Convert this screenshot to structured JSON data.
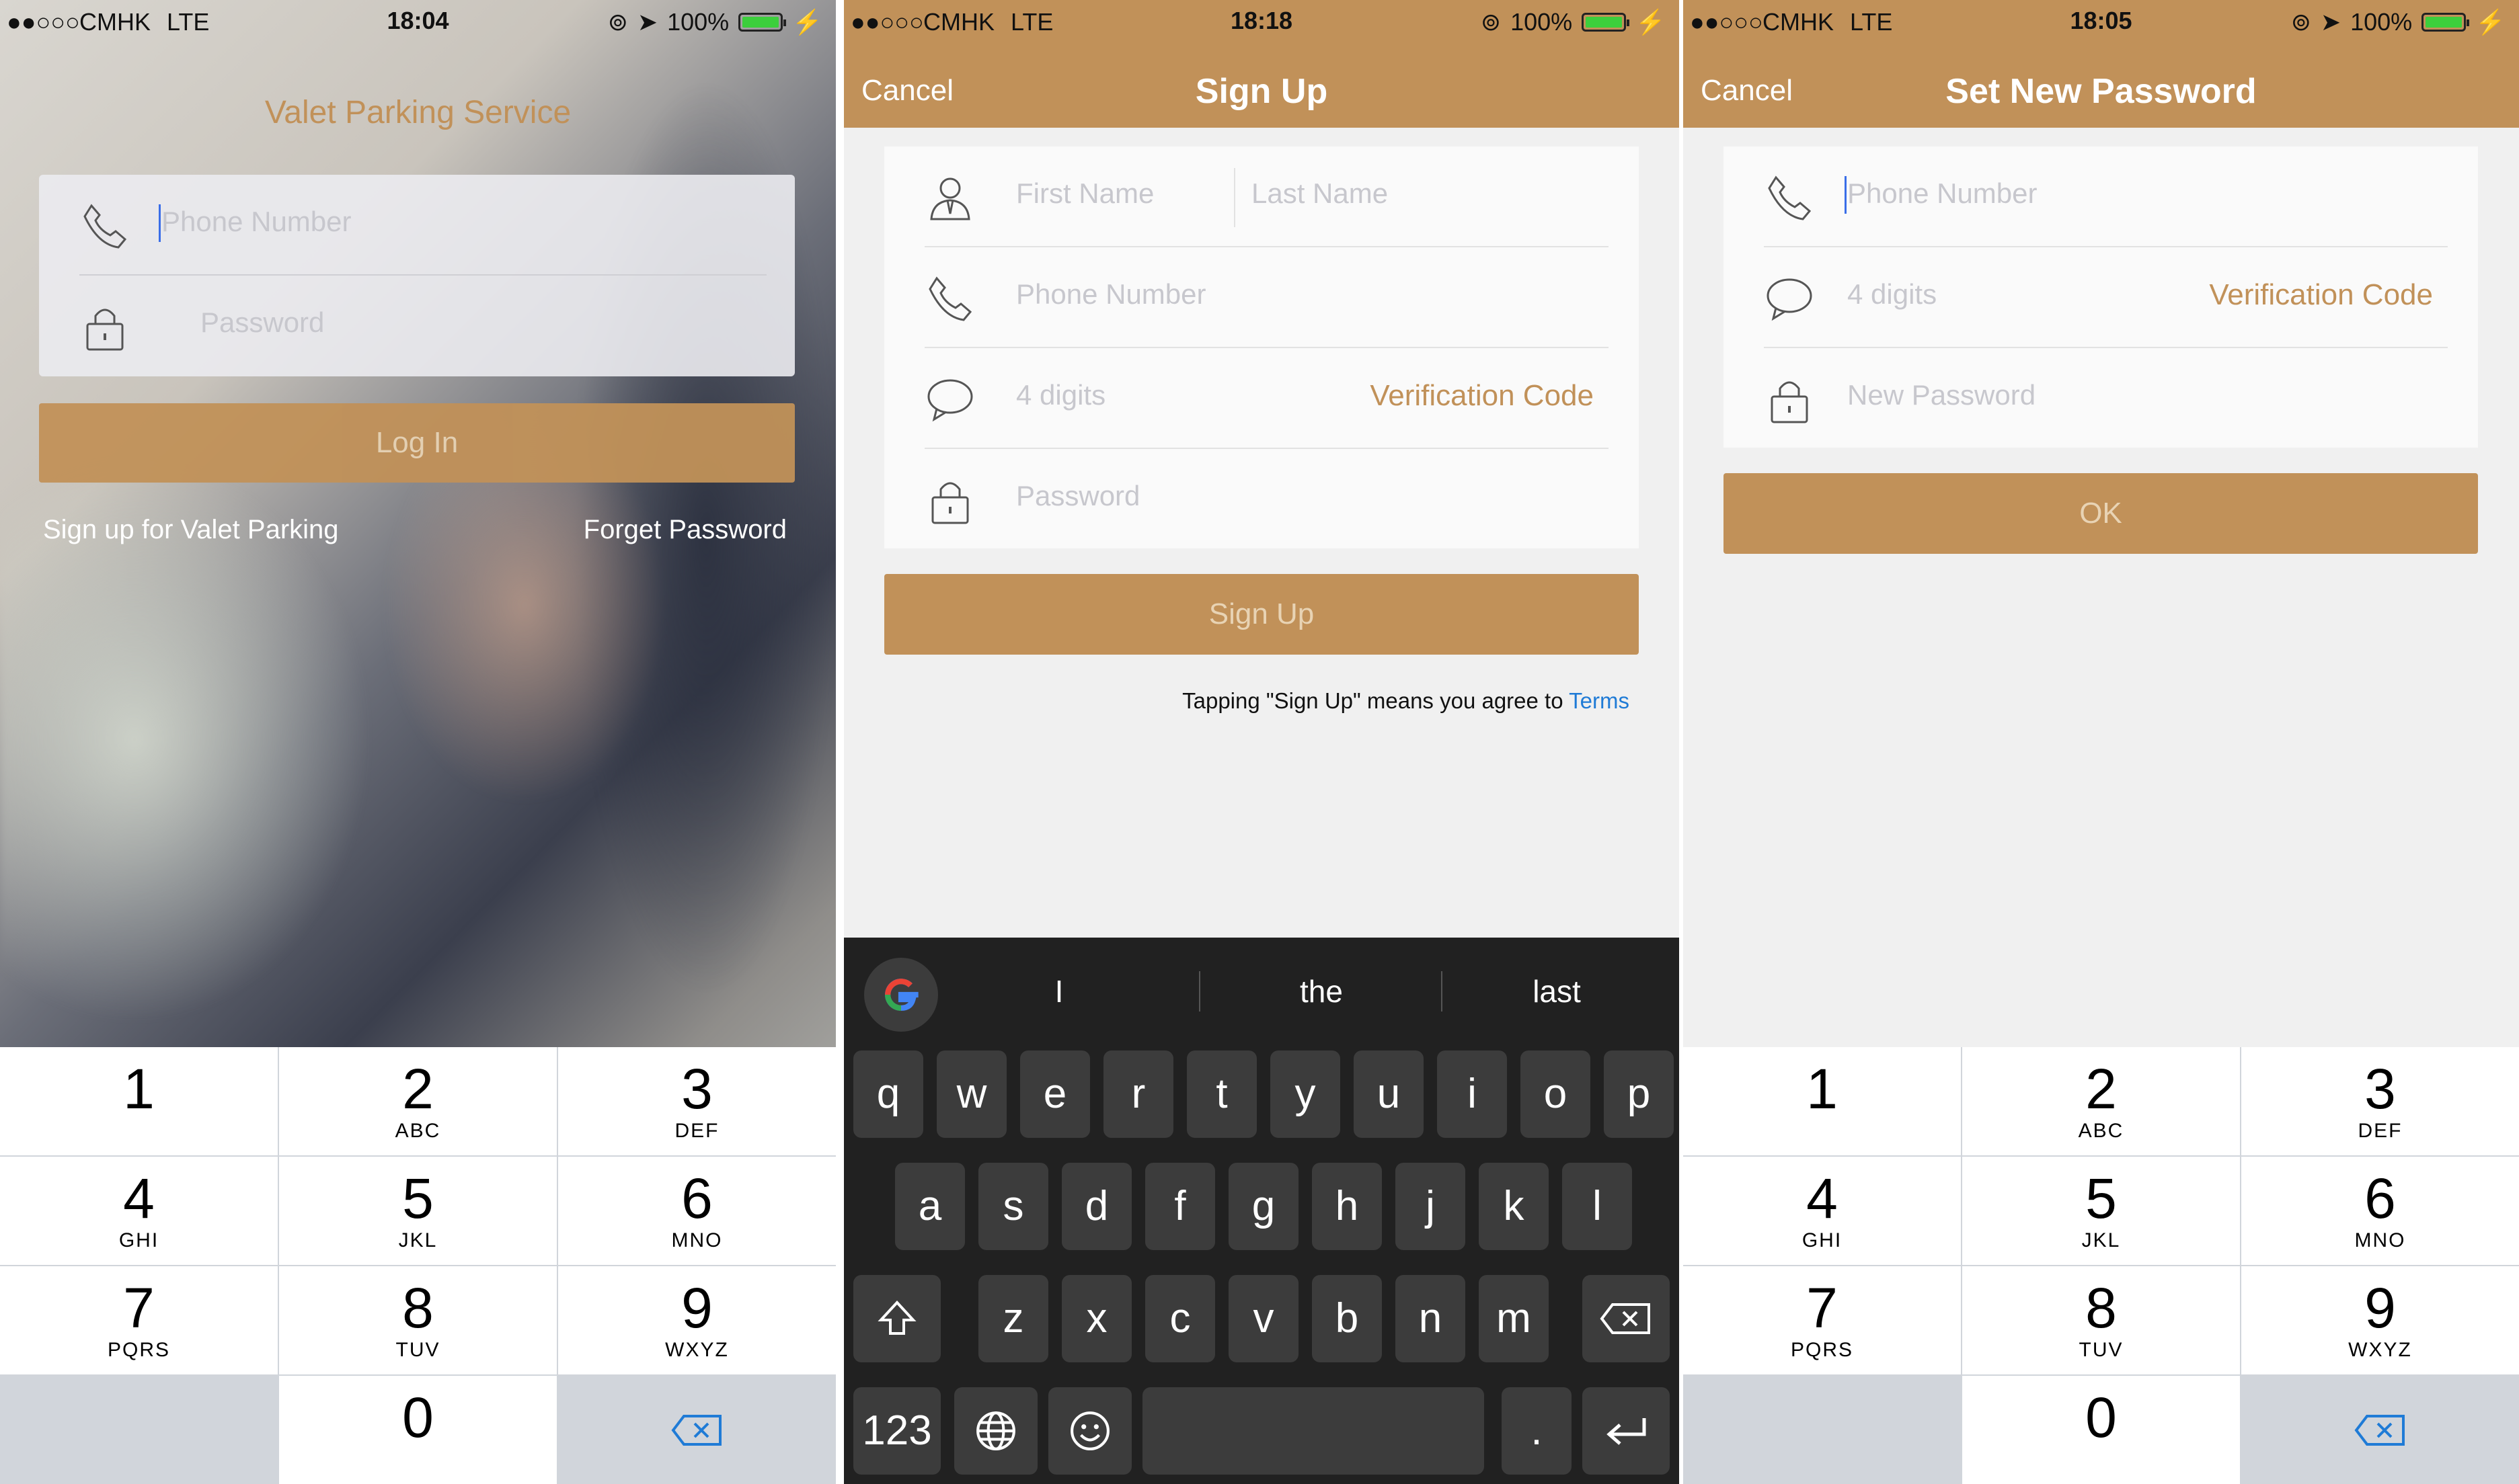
{
  "screen1": {
    "status": {
      "carrier": "CMHK",
      "network": "LTE",
      "time": "18:04",
      "battery": "100%"
    },
    "app_title": "Valet Parking Service",
    "phone_placeholder": "Phone Number",
    "password_placeholder": "Password",
    "login_label": "Log In",
    "signup_link": "Sign up for Valet Parking",
    "forget_link": "Forget Password"
  },
  "screen2": {
    "status": {
      "carrier": "CMHK",
      "network": "LTE",
      "time": "18:18",
      "battery": "100%"
    },
    "cancel": "Cancel",
    "title": "Sign Up",
    "first_name_placeholder": "First Name",
    "last_name_placeholder": "Last Name",
    "phone_placeholder": "Phone Number",
    "code_placeholder": "4 digits",
    "verification_code": "Verification Code",
    "password_placeholder": "Password",
    "signup_label": "Sign Up",
    "terms_text": "Tapping \"Sign Up\" means you agree to",
    "terms_link": "Terms",
    "keyboard": {
      "suggestions": [
        "I",
        "the",
        "last"
      ],
      "row1": [
        "q",
        "w",
        "e",
        "r",
        "t",
        "y",
        "u",
        "i",
        "o",
        "p"
      ],
      "row2": [
        "a",
        "s",
        "d",
        "f",
        "g",
        "h",
        "j",
        "k",
        "l"
      ],
      "row3": [
        "z",
        "x",
        "c",
        "v",
        "b",
        "n",
        "m"
      ],
      "num_key": "123",
      "period_key": "."
    }
  },
  "screen3": {
    "status": {
      "carrier": "CMHK",
      "network": "LTE",
      "time": "18:05",
      "battery": "100%"
    },
    "cancel": "Cancel",
    "title": "Set New Password",
    "phone_placeholder": "Phone Number",
    "code_placeholder": "4 digits",
    "verification_code": "Verification Code",
    "new_password_placeholder": "New Password",
    "ok_label": "OK"
  },
  "keypad": [
    {
      "n": "1",
      "l": ""
    },
    {
      "n": "2",
      "l": "ABC"
    },
    {
      "n": "3",
      "l": "DEF"
    },
    {
      "n": "4",
      "l": "GHI"
    },
    {
      "n": "5",
      "l": "JKL"
    },
    {
      "n": "6",
      "l": "MNO"
    },
    {
      "n": "7",
      "l": "PQRS"
    },
    {
      "n": "8",
      "l": "TUV"
    },
    {
      "n": "9",
      "l": "WXYZ"
    },
    {
      "n": "0",
      "l": ""
    }
  ],
  "colors": {
    "accent": "#c19159",
    "link": "#1f7bd6",
    "keyboard_dark": "#212121"
  }
}
